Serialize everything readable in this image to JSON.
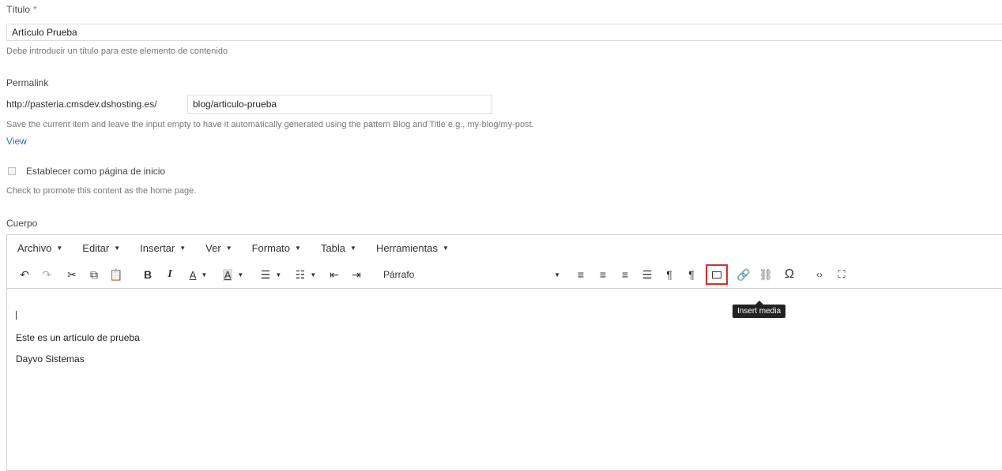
{
  "title_field": {
    "label": "Título",
    "required_mark": "*",
    "value": "Artículo Prueba",
    "help": "Debe introducir un título para este elemento de contenido"
  },
  "permalink": {
    "label": "Permalink",
    "prefix": "http://pasteria.cmsdev.dshosting.es/",
    "value": "blog/articulo-prueba",
    "help": "Save the current item and leave the input empty to have it automatically generated using the pattern Blog and Title e.g., my-blog/my-post.",
    "view_link": "View"
  },
  "homepage": {
    "checkbox_label": "Establecer como página de inicio",
    "help": "Check to promote this content as the home page.",
    "checked": false
  },
  "body": {
    "label": "Cuerpo",
    "menubar": [
      "Archivo",
      "Editar",
      "Insertar",
      "Ver",
      "Formato",
      "Tabla",
      "Herramientas"
    ],
    "format_select": "Párrafo",
    "tooltip": "Insert media",
    "lines": [
      "Este es un artículo de prueba",
      "Dayvo Sistemas"
    ]
  },
  "icons": {
    "undo": "undo-icon",
    "redo": "redo-icon",
    "cut": "cut-icon",
    "copy": "copy-icon",
    "paste": "paste-icon",
    "bold": "bold-icon",
    "italic": "italic-icon",
    "text_color": "text-color-icon",
    "bg_color": "background-color-icon",
    "bullet_list": "bullet-list-icon",
    "numbered_list": "numbered-list-icon",
    "outdent": "outdent-icon",
    "indent": "indent-icon",
    "align_left": "align-left-icon",
    "align_center": "align-center-icon",
    "align_right": "align-right-icon",
    "justify": "justify-icon",
    "ltr": "ltr-icon",
    "rtl": "rtl-icon",
    "media": "insert-media-icon",
    "link": "link-icon",
    "unlink": "unlink-icon",
    "special_char": "special-character-icon",
    "code": "source-code-icon",
    "fullscreen": "fullscreen-icon"
  },
  "colors": {
    "highlight": "#d32f2f",
    "link": "#2b6cb0",
    "required": "#e0584a"
  }
}
